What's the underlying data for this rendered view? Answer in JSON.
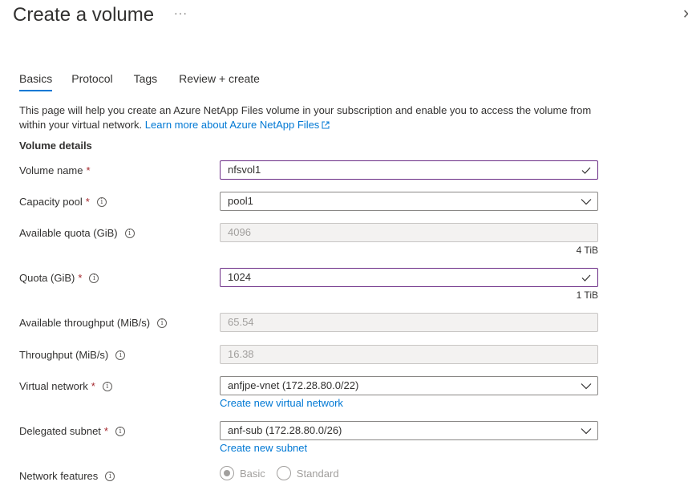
{
  "header": {
    "title": "Create a volume",
    "more": "···",
    "close": "✕"
  },
  "tabs": [
    {
      "label": "Basics",
      "active": true
    },
    {
      "label": "Protocol",
      "active": false
    },
    {
      "label": "Tags",
      "active": false
    },
    {
      "label": "Review + create",
      "active": false
    }
  ],
  "intro": {
    "text": "This page will help you create an Azure NetApp Files volume in your subscription and enable you to access the volume from within your virtual network.",
    "link": "Learn more about Azure NetApp Files"
  },
  "section_title": "Volume details",
  "fields": {
    "volume_name": {
      "label": "Volume name",
      "required": "*",
      "value": "nfsvol1"
    },
    "capacity_pool": {
      "label": "Capacity pool",
      "required": "*",
      "value": "pool1"
    },
    "available_quota": {
      "label": "Available quota (GiB)",
      "value": "4096",
      "hint": "4 TiB"
    },
    "quota": {
      "label": "Quota (GiB)",
      "required": "*",
      "value": "1024",
      "hint": "1 TiB"
    },
    "available_throughput": {
      "label": "Available throughput (MiB/s)",
      "value": "65.54"
    },
    "throughput": {
      "label": "Throughput (MiB/s)",
      "value": "16.38"
    },
    "virtual_network": {
      "label": "Virtual network",
      "required": "*",
      "value": "anfjpe-vnet (172.28.80.0/22)",
      "link": "Create new virtual network"
    },
    "delegated_subnet": {
      "label": "Delegated subnet",
      "required": "*",
      "value": "anf-sub (172.28.80.0/26)",
      "link": "Create new subnet"
    },
    "network_features": {
      "label": "Network features",
      "options": [
        "Basic",
        "Standard"
      ],
      "selected": "Basic"
    }
  },
  "colors": {
    "accent": "#0078d4",
    "valid_border": "#6b2d86",
    "required": "#a4262c"
  }
}
